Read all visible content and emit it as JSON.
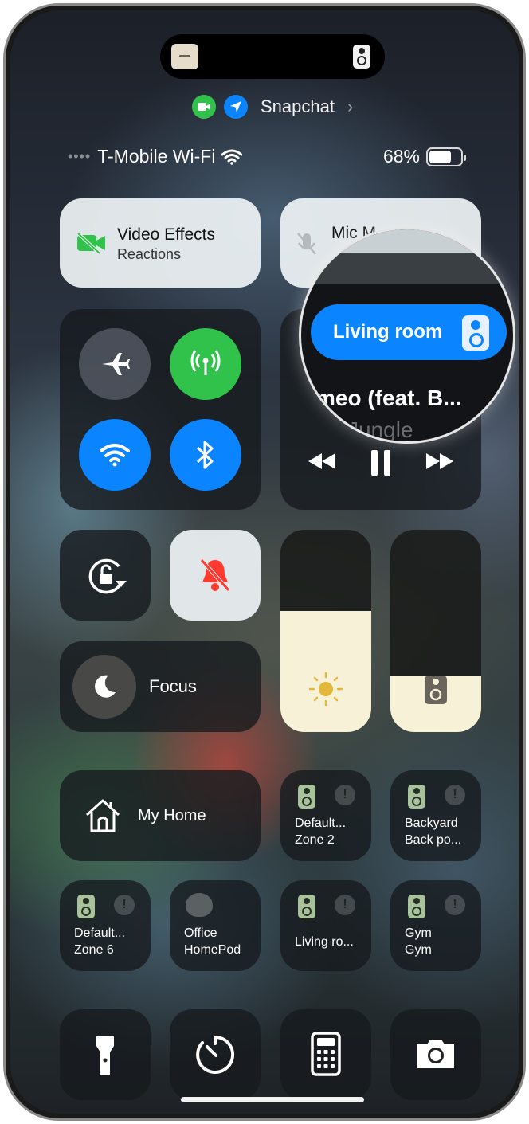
{
  "privacy": {
    "app_label": "Snapchat",
    "camera_icon": "video-icon",
    "location_icon": "location-arrow-icon"
  },
  "status": {
    "carrier": "T-Mobile Wi-Fi",
    "battery": "68%",
    "battery_level": 0.68
  },
  "tiles": {
    "video_effects_title": "Video Effects",
    "video_effects_sub": "Reactions",
    "mic_label": "Mic M"
  },
  "now_playing": {
    "output": "Living room",
    "song": "meo (feat. B...",
    "artist": "Jungle"
  },
  "focus": {
    "label": "Focus"
  },
  "sliders": {
    "brightness_level": 0.6,
    "volume_level": 0.28
  },
  "home": {
    "label": "My Home",
    "accessories": [
      {
        "line1": "Default...",
        "line2": "Zone 2"
      },
      {
        "line1": "Backyard",
        "line2": "Back po..."
      },
      {
        "line1": "Default...",
        "line2": "Zone 6"
      },
      {
        "line1": "Office",
        "line2": "HomePod"
      },
      {
        "line1": "Living ro...",
        "line2": ""
      },
      {
        "line1": "Gym",
        "line2": "Gym"
      }
    ]
  },
  "colors": {
    "accent_blue": "#0a84ff",
    "green": "#30c24a",
    "bell_red": "#ff3b30"
  }
}
